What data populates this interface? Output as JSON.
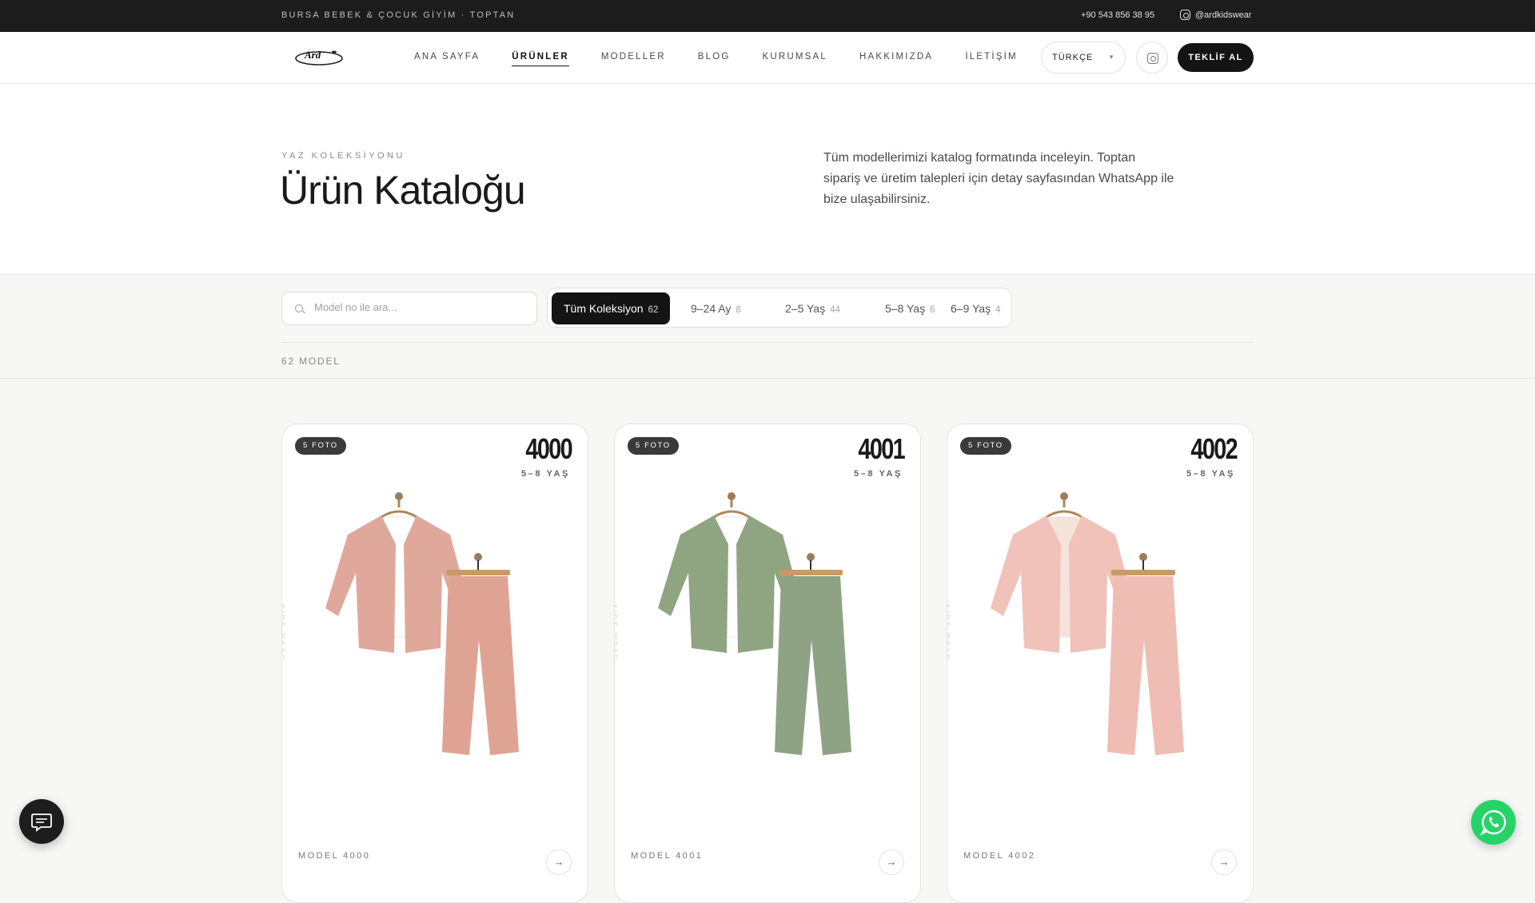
{
  "topbar": {
    "tagline": "BURSA BEBEK & ÇOCUK GİYİM · TOPTAN",
    "phone": "+90 543 856 38 95",
    "instagram": "@ardkidswear"
  },
  "nav": {
    "logo_text": "Ard",
    "items": [
      "ANA SAYFA",
      "ÜRÜNLER",
      "MODELLER",
      "BLOG",
      "KURUMSAL",
      "HAKKIMIZDA",
      "İLETİŞİM"
    ],
    "active_item": "ÜRÜNLER",
    "language": "TÜRKÇE",
    "cta_label": "TEKLİF AL"
  },
  "hero": {
    "eyebrow": "YAZ KOLEKSİYONU",
    "title": "Ürün Kataloğu",
    "description": "Tüm modellerimizi katalog formatında inceleyin. Toptan sipariş ve üretim talepleri için detay sayfasından WhatsApp ile bize ulaşabilirsiniz."
  },
  "filters": {
    "search_placeholder": "Model no ile ara...",
    "tabs": [
      {
        "label": "Tüm Koleksiyon",
        "count": "62",
        "active": true
      },
      {
        "label": "9–24 Ay",
        "count": "8",
        "active": false
      },
      {
        "label": "2–5 Yaş",
        "count": "44",
        "active": false
      },
      {
        "label": "5–8 Yaş",
        "count": "6",
        "active": false
      },
      {
        "label": "6–9 Yaş",
        "count": "4",
        "active": false
      }
    ],
    "result_count": "62 MODEL"
  },
  "products": [
    {
      "badge": "5 FOTO",
      "number": "4000",
      "age": "5–8 YAŞ",
      "label": "MODEL 4000",
      "watermark": "KIDS WEAR",
      "jacket_color": "#e0a89a",
      "pants_color": "#dfa394",
      "shirt_color": "#ffffff",
      "arrow": "→"
    },
    {
      "badge": "5 FOTO",
      "number": "4001",
      "age": "5–8 YAŞ",
      "label": "MODEL 4001",
      "watermark": "KIDS WEAR",
      "jacket_color": "#8fa581",
      "pants_color": "#8ea384",
      "shirt_color": "#ffffff",
      "arrow": "→"
    },
    {
      "badge": "5 FOTO",
      "number": "4002",
      "age": "5–8 YAŞ",
      "label": "MODEL 4002",
      "watermark": "KIDS WEAR",
      "jacket_color": "#f0c2b9",
      "pants_color": "#efbdb4",
      "shirt_color": "#f6e3dc",
      "arrow": "→"
    }
  ],
  "floating": {
    "chat_icon": "chat-bubble-icon",
    "whatsapp_icon": "whatsapp-icon"
  }
}
